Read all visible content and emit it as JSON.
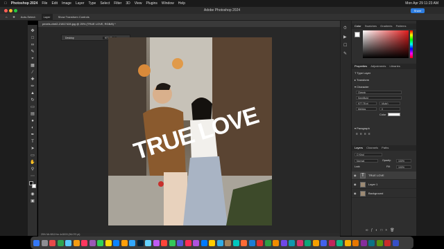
{
  "menubar": {
    "app": "Photoshop 2024",
    "items": [
      "File",
      "Edit",
      "Image",
      "Layer",
      "Type",
      "Select",
      "Filter",
      "3D",
      "View",
      "Plugins",
      "Window",
      "Help"
    ],
    "clock": "Mon Apr 29 11:23 AM"
  },
  "window": {
    "title": "Adobe Photoshop 2024",
    "share": "Share"
  },
  "options_bar": {
    "auto_select": "Auto-Select:",
    "layer": "Layer",
    "transform": "Show Transform Controls"
  },
  "document_tab": "pexels-vimt2-21817428.jpg @ 25% (TRUE LOVE, RGB/8) *",
  "overlay_text": "TRUE LOVE",
  "small_panel": {
    "label": "Desktop",
    "value": "977.78 pt"
  },
  "status": "25%   Nh 9813 fm 4x3003 (96.070 pt)",
  "panels": {
    "color_tabs": [
      "Color",
      "Swatches",
      "Gradients",
      "Patterns"
    ],
    "props_tabs": [
      "Properties",
      "Adjustments",
      "Libraries"
    ],
    "type_layer": "Type Layer",
    "transform": "Transform",
    "character": "Character",
    "font_family": "Classic",
    "font_style": "SemiBold",
    "size": "977.78 pt",
    "leading": "(Auto)",
    "tracking": "Metrics",
    "kerning": "0",
    "color_label": "Color",
    "paragraph": "Paragraph"
  },
  "layers_panel": {
    "tabs": [
      "Layers",
      "Channels",
      "Paths"
    ],
    "kind": "Q Kind",
    "blend": "Normal",
    "opacity_label": "Opacity:",
    "opacity": "100%",
    "lock_label": "Lock:",
    "fill_label": "Fill:",
    "fill": "100%",
    "layers": [
      {
        "name": "TRUE LOVE",
        "thumb": "T"
      },
      {
        "name": "Layer 1",
        "thumb": ""
      },
      {
        "name": "Background",
        "thumb": ""
      }
    ]
  },
  "dock_colors": [
    "#3478f6",
    "#8e8e93",
    "#e84a4a",
    "#2ea44f",
    "#5ac8fa",
    "#f39c12",
    "#ff375f",
    "#9b59b6",
    "#30d158",
    "#ffd60a",
    "#0a84ff",
    "#ff9f0a",
    "#31a8ff",
    "#001e36",
    "#64d2ff",
    "#bf5af2",
    "#ff453a",
    "#34c759",
    "#5856d6",
    "#ff2d55",
    "#af52de",
    "#007aff",
    "#ffcc00",
    "#32ade6",
    "#a2845e",
    "#00c7be",
    "#ff6b35",
    "#1c7ed6",
    "#e03131",
    "#2f9e44",
    "#f08c00",
    "#7048e8",
    "#1098ad",
    "#d6336c",
    "#0ca678",
    "#f59f00",
    "#4263eb",
    "#c2255c",
    "#12b886",
    "#fab005",
    "#e67700",
    "#862e9c",
    "#0b7285",
    "#5c940d",
    "#c92a2a",
    "#364fc7"
  ],
  "accent": "#2d7de0"
}
